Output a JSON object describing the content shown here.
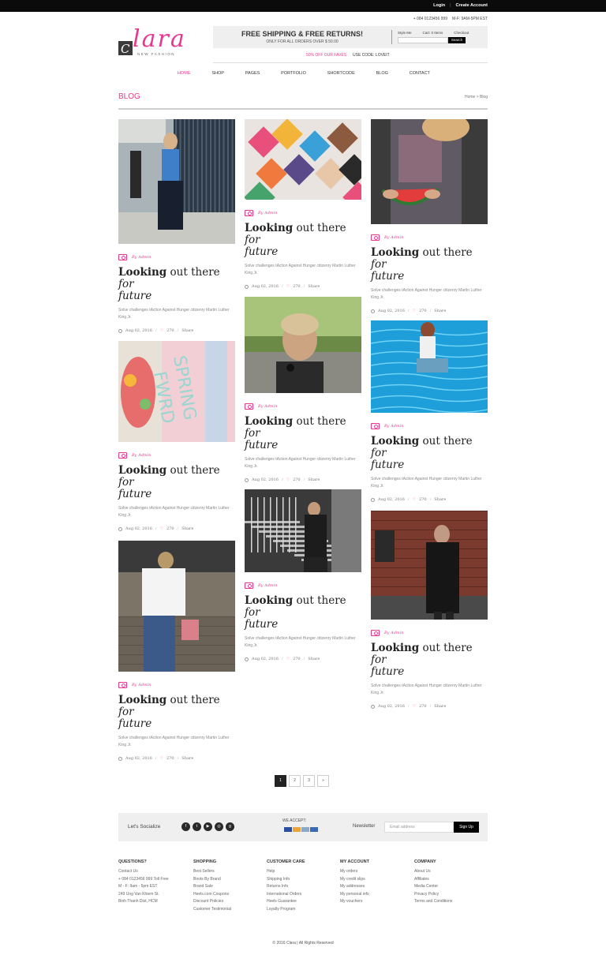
{
  "topbar": {
    "login": "Login",
    "separator": "|",
    "create_account": "Create Account"
  },
  "contact": {
    "phone": "+ 084 0123456 999",
    "hours": "M-F: 9AM-5PM EST"
  },
  "logo": {
    "wordmark": "lara",
    "initial": "C",
    "tagline": "NEW FASHION"
  },
  "promo": {
    "headline": "FREE SHIPPING & FREE RETURNS!",
    "subline": "ONLY FOR ALL ORDERS OVER $ 50.00",
    "style_me": "Style Me",
    "cart": "Cart: 0 Items",
    "checkout": "Checkout",
    "search_button": "Search"
  },
  "offer": {
    "deal": "50% OFF OUR FAVES",
    "code": "USE CODE: LOVEIT"
  },
  "nav": [
    "HOME",
    "SHOP",
    "PAGES",
    "PORTFOLIO",
    "SHORTCODE",
    "BLOG",
    "CONTACT"
  ],
  "page": {
    "title": "BLOG",
    "breadcrumb": "Home > Blog"
  },
  "post": {
    "author": "By Admin",
    "title_bold": "Looking",
    "title_mid": " out there ",
    "title_italic1": "for",
    "title_italic2": "future",
    "excerpt": "Solve challenges tAction Against Hunger citizenry Martin Luther King Jr.",
    "date": "Aug 02, 2016",
    "likes": "270",
    "share": "Share"
  },
  "pagination": [
    "1",
    "2",
    "3",
    "»"
  ],
  "footer_strip": {
    "lets_socialize": "Let's Socialize",
    "social_icons": [
      "facebook-icon",
      "twitter-icon",
      "youtube-icon",
      "instagram-icon",
      "google-plus-icon"
    ],
    "we_accept": "WE ACCEPT:",
    "newsletter": "Newsletter",
    "email_placeholder": "Email address",
    "signup": "Sign Up"
  },
  "footer_cols": [
    {
      "title": "QUESTIONS?",
      "items": [
        "Contact Us",
        "+ 084 0123456 999 Toll Free",
        "M - F: 9am - 5pm EST",
        "249 Ung Van Khiem St.",
        "Binh Thanh Dist, HCM"
      ]
    },
    {
      "title": "SHOPPING",
      "items": [
        "Best Sellers",
        "Boots By Brand",
        "Brand Sale",
        "Heels.com Coupons",
        "Discount Policies",
        "Customer Testimonial"
      ]
    },
    {
      "title": "CUSTOMER CARE",
      "items": [
        "Help",
        "Shipping Info",
        "Returns Info",
        "International Orders",
        "Heels Guarantee",
        "Loyalty Program"
      ]
    },
    {
      "title": "MY ACCOUNT",
      "items": [
        "My orders",
        "My credit slips",
        "My addresses",
        "My personal info",
        "My vouchers"
      ]
    },
    {
      "title": "COMPANY",
      "items": [
        "About Us",
        "Affiliates",
        "Media Center",
        "Privacy Policy",
        "Terms and Conditions"
      ]
    }
  ],
  "copyright": "© 2016 Clara  |  All Rights Reserved",
  "colors": {
    "accent": "#e9378f",
    "topbar": "#0b0b0b",
    "strip": "#efefef"
  }
}
